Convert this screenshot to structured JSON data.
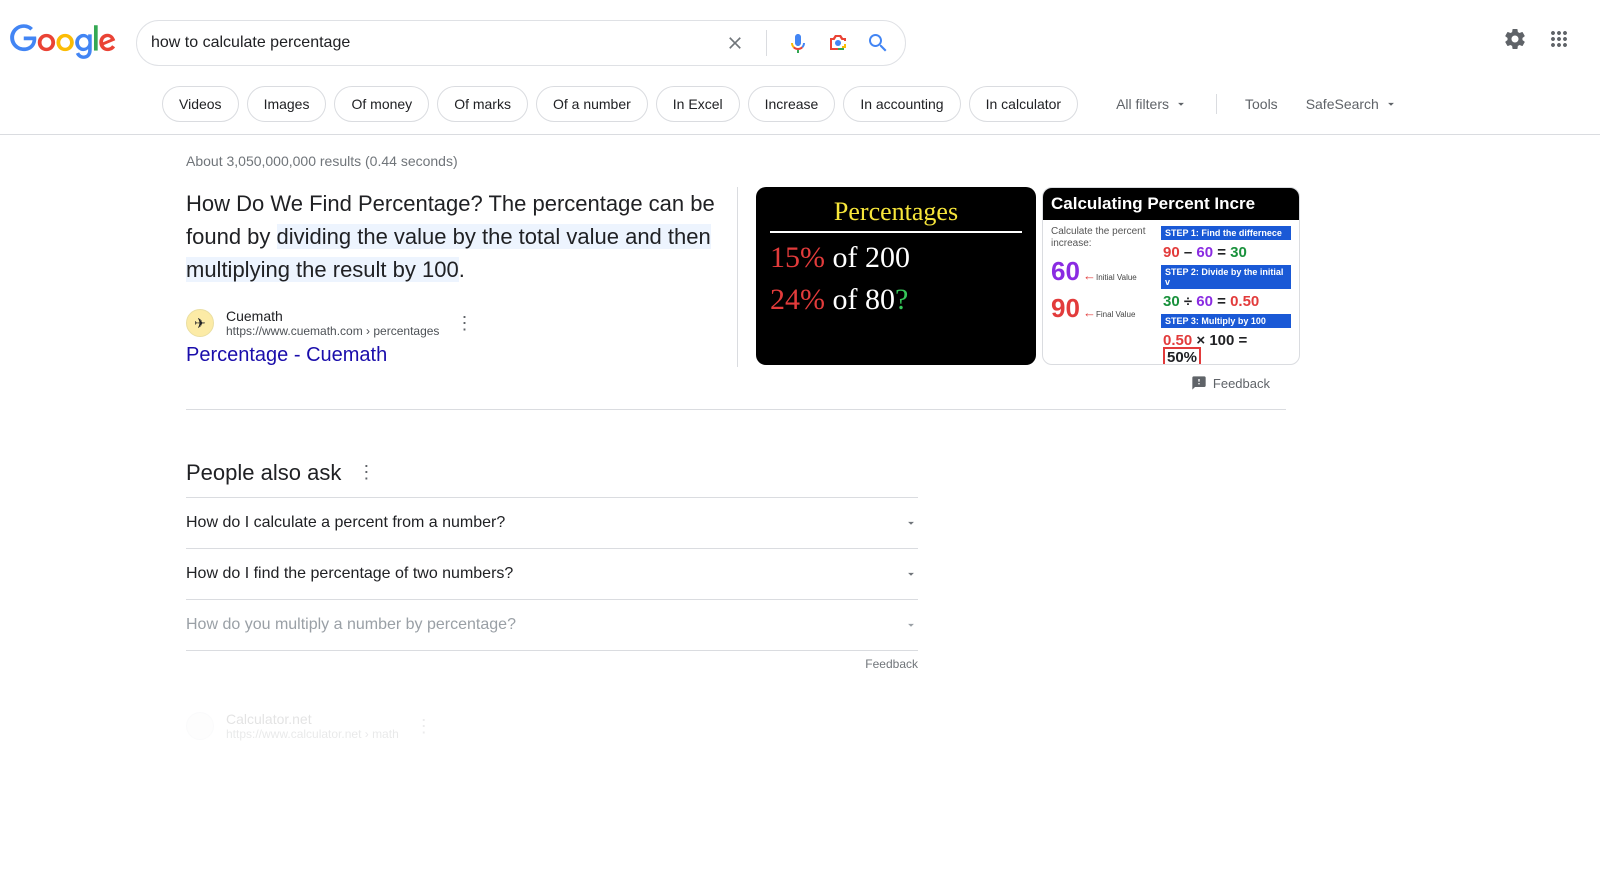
{
  "search": {
    "query": "how to calculate percentage"
  },
  "chips": [
    "Videos",
    "Images",
    "Of money",
    "Of marks",
    "Of a number",
    "In Excel",
    "Increase",
    "In accounting",
    "In calculator"
  ],
  "tools": {
    "all_filters": "All filters",
    "tools": "Tools",
    "safesearch": "SafeSearch"
  },
  "stats": "About 3,050,000,000 results (0.44 seconds)",
  "featured": {
    "snippet_prefix": "How Do We Find Percentage? The percentage can be found by ",
    "snippet_hl": "dividing the value by the total value and then multiplying the result by 100",
    "snippet_suffix": ".",
    "source_name": "Cuemath",
    "source_url": "https://www.cuemath.com › percentages",
    "link_title": "Percentage - Cuemath",
    "thumb1": {
      "title": "Percentages",
      "row1_pct": "15%",
      "row1_mid": " of ",
      "row1_val": "200",
      "row2_pct": "24%",
      "row2_mid": " of ",
      "row2_val": "80",
      "row2_q": "?"
    },
    "thumb2": {
      "head": "Calculating Percent Incre",
      "calc_label": "Calculate the percent increase:",
      "initial_val": "60",
      "initial_lbl": "Initial\nValue",
      "final_val": "90",
      "final_lbl": "Final\nValue",
      "step1_head": "STEP 1:  Find the differnece",
      "step1_eq_a": "90",
      "step1_eq_b": "60",
      "step1_eq_r": "30",
      "step2_head": "STEP 2: Divide by the initial v",
      "step2_eq_a": "30",
      "step2_eq_b": "60",
      "step2_eq_r": "0.50",
      "step3_head": "STEP 3: Multiply by 100",
      "step3_eq_a": "0.50",
      "step3_eq_b": "100",
      "step3_eq_r": "50%"
    }
  },
  "feedback_label": "Feedback",
  "paa": {
    "title": "People also ask",
    "items": [
      {
        "q": "How do I calculate a percent from a number?",
        "faded": false
      },
      {
        "q": "How do I find the percentage of two numbers?",
        "faded": false
      },
      {
        "q": "How do you multiply a number by percentage?",
        "faded": true
      }
    ],
    "feedback": "Feedback"
  },
  "upcoming": {
    "name": "Calculator.net",
    "url": "https://www.calculator.net › math"
  }
}
